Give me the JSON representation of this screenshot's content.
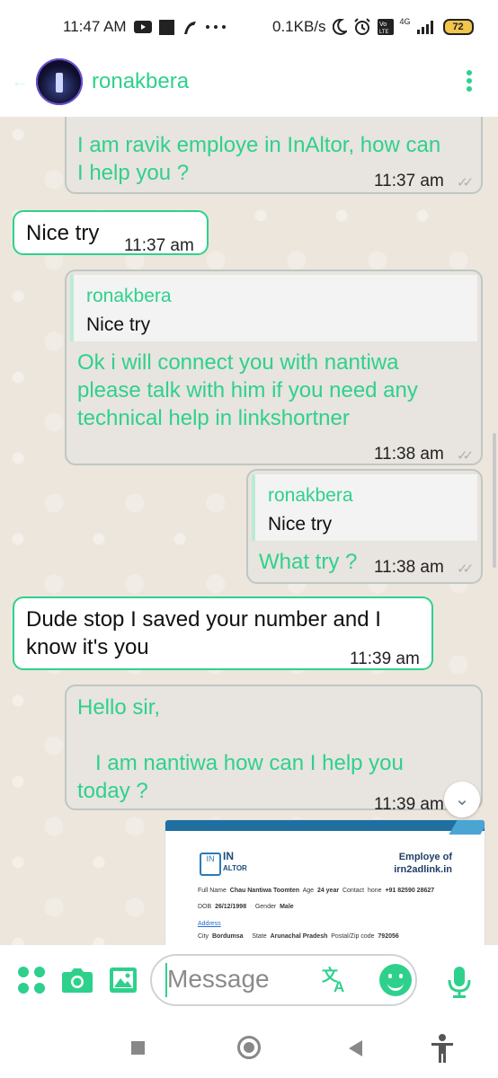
{
  "status_bar": {
    "time": "11:47 AM",
    "network_speed": "0.1KB/s",
    "network_type": "4G",
    "battery": "72",
    "icons": [
      "youtube-icon",
      "square-notification-icon",
      "app-notification-icon",
      "more-notifications-icon",
      "moon-icon",
      "alarm-icon",
      "volte-icon",
      "signal-icon",
      "battery-icon"
    ]
  },
  "header": {
    "contact_name": "ronakbera"
  },
  "messages": [
    {
      "id": "m1",
      "direction": "out",
      "lines": [
        "I am ravik employe in InAltor, how can",
        "I help you ?"
      ],
      "time": "11:37 am"
    },
    {
      "id": "m2",
      "direction": "in",
      "lines": [
        "Nice try"
      ],
      "time": "11:37 am"
    },
    {
      "id": "m3",
      "direction": "out",
      "quote_author": "ronakbera",
      "quote_text": "Nice try",
      "lines": [
        "Ok i will connect you with nantiwa",
        "please talk with him if you need any",
        "technical help in linkshortner"
      ],
      "time": "11:38 am"
    },
    {
      "id": "m4",
      "direction": "out",
      "quote_author": "ronakbera",
      "quote_text": "Nice try",
      "lines": [
        "What try ?"
      ],
      "time": "11:38 am"
    },
    {
      "id": "m5",
      "direction": "in",
      "lines": [
        "Dude stop I saved your number and I",
        "know it's you"
      ],
      "time": "11:39 am"
    },
    {
      "id": "m6",
      "direction": "out",
      "lines": [
        "Hello sir,",
        "",
        "   I am nantiwa how can I help you",
        "today ?"
      ],
      "time": "11:39 am"
    }
  ],
  "document_preview": {
    "logo_text": "IN",
    "brand_line1": "IN",
    "brand_line2": "ALTOR",
    "title_line1": "Employe of",
    "title_line2": "irn2adlink.in",
    "full_name_label": "Full Name",
    "full_name": "Chau Nantiwa Toomten",
    "age_label": "Age",
    "age": "24 year",
    "contact_label": "Contact",
    "phone_label": "hone",
    "phone": "+91 82590 28627",
    "dob_label": "DOB",
    "dob": "26/12/1998",
    "gender_label": "Gender",
    "gender": "Male",
    "address_label": "Address",
    "city_label": "City",
    "city": "Bordumsa",
    "state_label": "State",
    "state": "Arunachal Pradesh",
    "postal_label": "Postal/Zip code",
    "postal": "792056"
  },
  "composer": {
    "placeholder": "Message"
  },
  "colors": {
    "accent": "#2ed18c",
    "chat_background": "#ede6dd",
    "outgoing_bubble": "#e8e4df",
    "incoming_bubble": "#ffffff"
  }
}
